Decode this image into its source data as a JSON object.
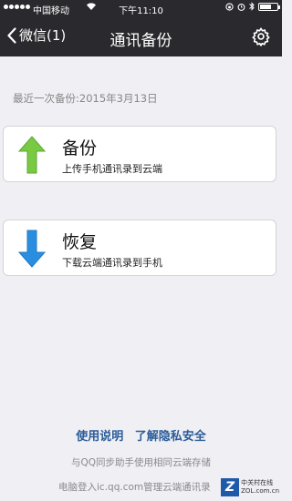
{
  "status_bar": {
    "carrier": "中国移动",
    "wifi_icon": "wifi-icon",
    "time": "下午11:10",
    "alarm_icon": "alarm-icon",
    "battery_icon": "battery-icon"
  },
  "nav": {
    "back_label": "微信(1)",
    "title": "通讯备份",
    "settings_icon": "gear-icon"
  },
  "last_backup": "最近一次备份:2015年3月13日",
  "backup_card": {
    "title": "备份",
    "subtitle": "上传手机通讯录到云端",
    "icon": "arrow-up-icon",
    "color": "#6cc644"
  },
  "restore_card": {
    "title": "恢复",
    "subtitle": "下载云端通讯录到手机",
    "icon": "arrow-down-icon",
    "color": "#2a8ee0"
  },
  "footer": {
    "link_usage": "使用说明",
    "link_privacy": "了解隐私安全",
    "note1": "与QQ同步助手使用相同云端存储",
    "note2": "电脑登入ic.qq.com管理云端通讯录"
  },
  "watermark": {
    "logo": "Z",
    "line1": "中关村在线",
    "line2": "ZOL.com.cn"
  }
}
